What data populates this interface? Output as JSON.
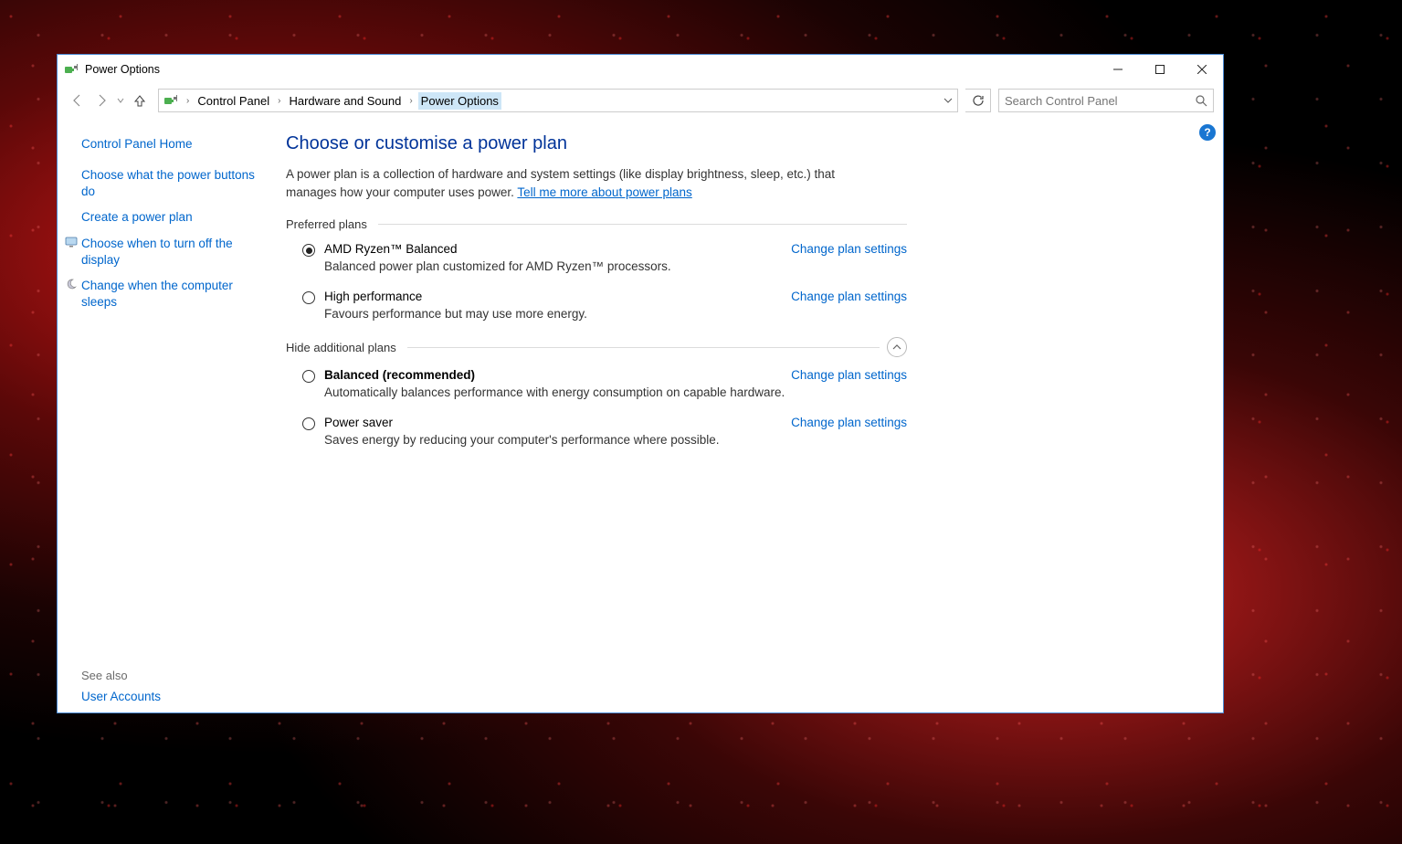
{
  "titlebar": {
    "title": "Power Options"
  },
  "breadcrumb": {
    "items": [
      "Control Panel",
      "Hardware and Sound",
      "Power Options"
    ]
  },
  "search": {
    "placeholder": "Search Control Panel"
  },
  "sidebar": {
    "home": "Control Panel Home",
    "links": [
      {
        "label": "Choose what the power buttons do",
        "icon": ""
      },
      {
        "label": "Create a power plan",
        "icon": ""
      },
      {
        "label": "Choose when to turn off the display",
        "icon": "monitor"
      },
      {
        "label": "Change when the computer sleeps",
        "icon": "moon"
      }
    ],
    "see_also_label": "See also",
    "see_also": [
      "User Accounts"
    ]
  },
  "main": {
    "heading": "Choose or customise a power plan",
    "description_pre": "A power plan is a collection of hardware and system settings (like display brightness, sleep, etc.) that manages how your computer uses power. ",
    "description_link": "Tell me more about power plans",
    "preferred_label": "Preferred plans",
    "hide_label": "Hide additional plans",
    "change_settings_label": "Change plan settings",
    "plans_preferred": [
      {
        "name": "AMD Ryzen™ Balanced",
        "desc": "Balanced power plan customized for AMD Ryzen™ processors.",
        "selected": true,
        "bold": false
      },
      {
        "name": "High performance",
        "desc": "Favours performance but may use more energy.",
        "selected": false,
        "bold": false
      }
    ],
    "plans_additional": [
      {
        "name": "Balanced (recommended)",
        "desc": "Automatically balances performance with energy consumption on capable hardware.",
        "selected": false,
        "bold": true
      },
      {
        "name": "Power saver",
        "desc": "Saves energy by reducing your computer's performance where possible.",
        "selected": false,
        "bold": false
      }
    ]
  },
  "help_badge": "?"
}
